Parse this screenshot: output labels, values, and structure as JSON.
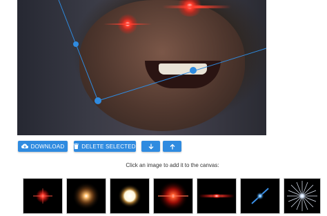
{
  "toolbar": {
    "download_label": "DOWNLOAD",
    "delete_label": "DELETE SELECTED",
    "move_down_icon": "arrow-down-icon",
    "move_up_icon": "arrow-up-icon",
    "accent_color": "#2f8be0"
  },
  "gallery": {
    "instruction": "Click an image to add it to the canvas:",
    "items": [
      {
        "icon": "red-sparkle-flare"
      },
      {
        "icon": "orange-glow-flare"
      },
      {
        "icon": "white-orb-flare"
      },
      {
        "icon": "red-burst-flare"
      },
      {
        "icon": "red-horizontal-streak-flare"
      },
      {
        "icon": "blue-diagonal-streak-flare"
      },
      {
        "icon": "white-star-flare"
      }
    ]
  }
}
